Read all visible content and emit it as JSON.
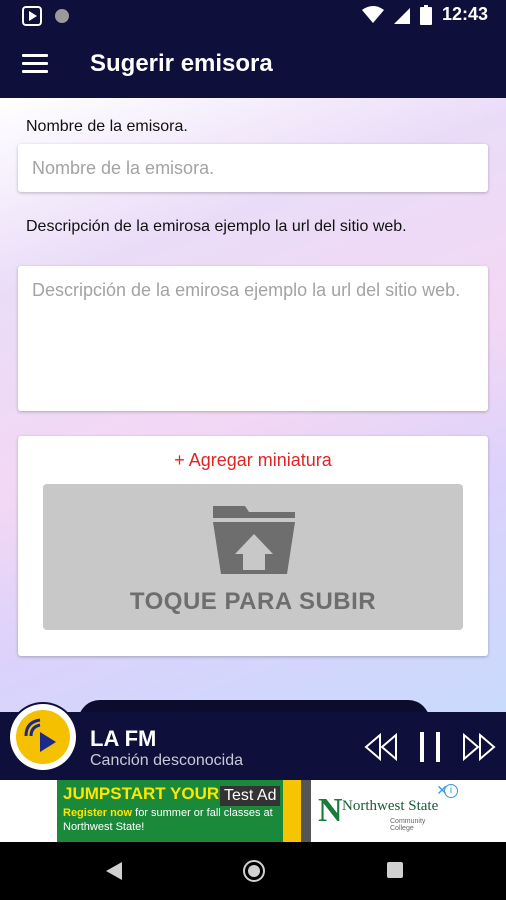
{
  "status_bar": {
    "time": "12:43"
  },
  "app_bar": {
    "title": "Sugerir emisora"
  },
  "form": {
    "name_label": "Nombre de la emisora.",
    "name_placeholder": "Nombre de la emisora.",
    "description_label": "Descripción de la emirosa ejemplo la url del sitio web.",
    "description_placeholder": "Descripción de la emirosa ejemplo la url del sitio web.",
    "add_thumbnail": "+ Agregar miniatura",
    "upload_text": "TOQUE PARA SUBIR"
  },
  "player": {
    "station": "LA FM",
    "track": "Canción desconocida"
  },
  "ad": {
    "headline": "JUMPSTART YOUR F",
    "body_em": "Register now",
    "body": " for summer or fall classes at Northwest State!",
    "test_label": "Test Ad",
    "brand": "Northwest State",
    "brand_sub": "Community College"
  },
  "colors": {
    "bar": "#0e0f3a",
    "accent": "#e32424",
    "logo": "#f5c000"
  }
}
